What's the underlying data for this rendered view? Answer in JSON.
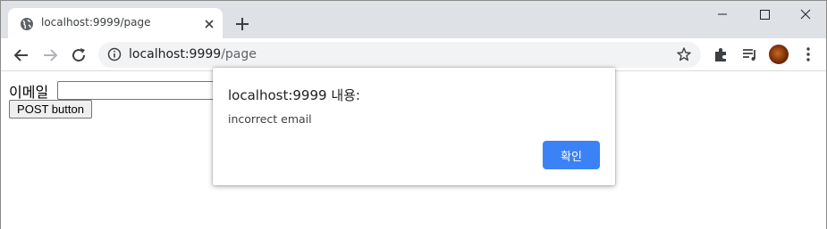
{
  "browser": {
    "tab": {
      "title": "localhost:9999/page"
    },
    "address_bar": {
      "host": "localhost:9999",
      "path": "/page"
    }
  },
  "page": {
    "email_label": "이메일",
    "email_value": "",
    "post_button_label": "POST button"
  },
  "alert": {
    "title": "localhost:9999 내용:",
    "message": "incorrect email",
    "ok_label": "확인"
  },
  "colors": {
    "tabstrip": "#dee1e6",
    "omnibox": "#f1f3f4",
    "dialog_button": "#3b82f6"
  },
  "icons": [
    "globe-icon",
    "close-icon",
    "plus-icon",
    "minimize-icon",
    "maximize-icon",
    "back-arrow-icon",
    "forward-arrow-icon",
    "reload-icon",
    "info-icon",
    "star-icon",
    "puzzle-icon",
    "media-queue-icon",
    "kebab-menu-icon"
  ]
}
